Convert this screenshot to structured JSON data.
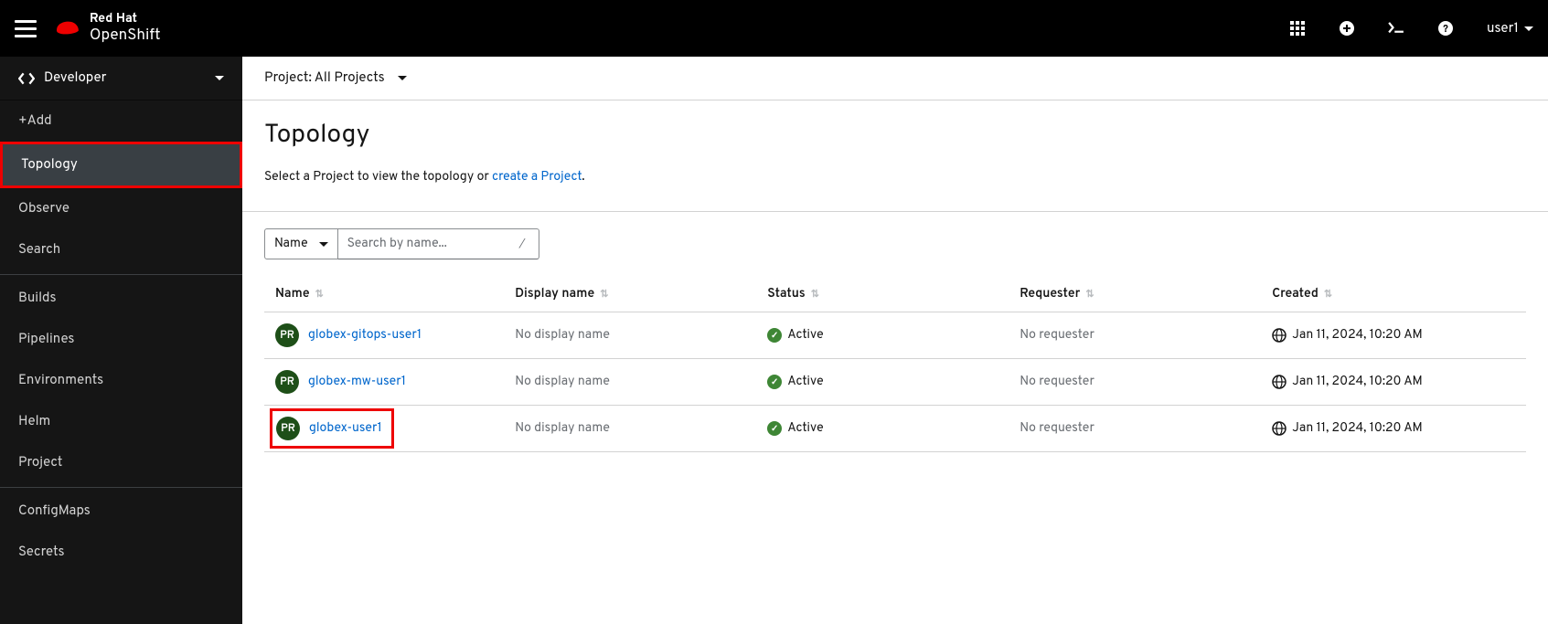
{
  "masthead": {
    "brand_top": "Red Hat",
    "brand_bot": "OpenShift",
    "user": "user1"
  },
  "perspective": {
    "label": "Developer"
  },
  "nav": [
    {
      "label": "+Add"
    },
    {
      "label": "Topology",
      "active": true
    },
    {
      "label": "Observe"
    },
    {
      "label": "Search"
    },
    {
      "label": "Builds",
      "break": true
    },
    {
      "label": "Pipelines"
    },
    {
      "label": "Environments"
    },
    {
      "label": "Helm"
    },
    {
      "label": "Project"
    },
    {
      "label": "ConfigMaps",
      "break": true
    },
    {
      "label": "Secrets"
    }
  ],
  "project_bar": {
    "label_prefix": "Project: ",
    "value": "All Projects"
  },
  "page": {
    "title": "Topology",
    "help_pre": "Select a Project to view the topology or ",
    "help_link": "create a Project",
    "help_post": "."
  },
  "toolbar": {
    "filter_label": "Name",
    "search_placeholder": "Search by name...",
    "search_hint": "/"
  },
  "columns": {
    "name": "Name",
    "display": "Display name",
    "status": "Status",
    "requester": "Requester",
    "created": "Created"
  },
  "rows": [
    {
      "badge": "PR",
      "name": "globex-gitops-user1",
      "display": "No display name",
      "status": "Active",
      "requester": "No requester",
      "created": "Jan 11, 2024, 10:20 AM",
      "highlight": false
    },
    {
      "badge": "PR",
      "name": "globex-mw-user1",
      "display": "No display name",
      "status": "Active",
      "requester": "No requester",
      "created": "Jan 11, 2024, 10:20 AM",
      "highlight": false
    },
    {
      "badge": "PR",
      "name": "globex-user1",
      "display": "No display name",
      "status": "Active",
      "requester": "No requester",
      "created": "Jan 11, 2024, 10:20 AM",
      "highlight": true
    }
  ]
}
